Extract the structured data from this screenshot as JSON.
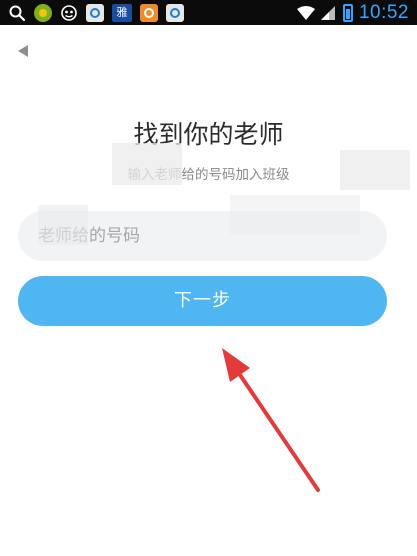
{
  "status_bar": {
    "time": "10:52",
    "notification_app_label": "雅",
    "icons": [
      "search-icon",
      "ball-icon",
      "mask-icon",
      "app-icon",
      "ya-icon",
      "game-icon",
      "app-icon",
      "wifi-icon",
      "signal-icon",
      "battery-icon"
    ]
  },
  "header": {
    "back_icon": "back-triangle-icon"
  },
  "main": {
    "title": "找到你的老师",
    "subtitle": "输入老师给的号码加入班级",
    "input_placeholder": "老师给的号码",
    "next_label": "下一步"
  },
  "colors": {
    "accent": "#4fb6f2",
    "annotation": "#e33b3b",
    "status_time": "#34a4ff"
  }
}
